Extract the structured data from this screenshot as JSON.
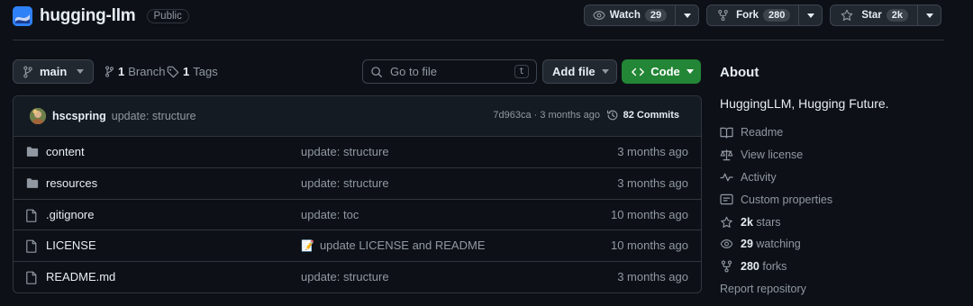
{
  "repo": {
    "name": "hugging-llm",
    "visibility": "Public"
  },
  "actions": {
    "watch": {
      "label": "Watch",
      "count": "29"
    },
    "fork": {
      "label": "Fork",
      "count": "280"
    },
    "star": {
      "label": "Star",
      "count": "2k"
    }
  },
  "toolbar": {
    "branch": "main",
    "branches_count": "1",
    "branches_label": "Branch",
    "tags_count": "1",
    "tags_label": "Tags",
    "goto_placeholder": "Go to file",
    "goto_shortcut": "t",
    "add_file": "Add file",
    "code": "Code"
  },
  "commit": {
    "author": "hscspring",
    "message": "update: structure",
    "meta": "7d963ca · 3 months ago",
    "commits_count": "82 Commits"
  },
  "files": [
    {
      "type": "folder",
      "name": "content",
      "message": "update: structure",
      "date": "3 months ago"
    },
    {
      "type": "folder",
      "name": "resources",
      "message": "update: structure",
      "date": "3 months ago"
    },
    {
      "type": "file",
      "name": ".gitignore",
      "message": "update: toc",
      "date": "10 months ago"
    },
    {
      "type": "file",
      "name": "LICENSE",
      "message": "update LICENSE and README",
      "date": "10 months ago",
      "emoji": "📝"
    },
    {
      "type": "file",
      "name": "README.md",
      "message": "update: structure",
      "date": "3 months ago"
    }
  ],
  "about": {
    "title": "About",
    "description": "HuggingLLM, Hugging Future.",
    "readme": "Readme",
    "license": "View license",
    "activity": "Activity",
    "custom_properties": "Custom properties",
    "stars_count": "2k",
    "stars_label": "stars",
    "watching_count": "29",
    "watching_label": "watching",
    "forks_count": "280",
    "forks_label": "forks",
    "report": "Report repository"
  },
  "colors": {
    "accent_green": "#238636",
    "bg": "#0d1117",
    "border": "#30363d",
    "muted": "#9198a1"
  }
}
